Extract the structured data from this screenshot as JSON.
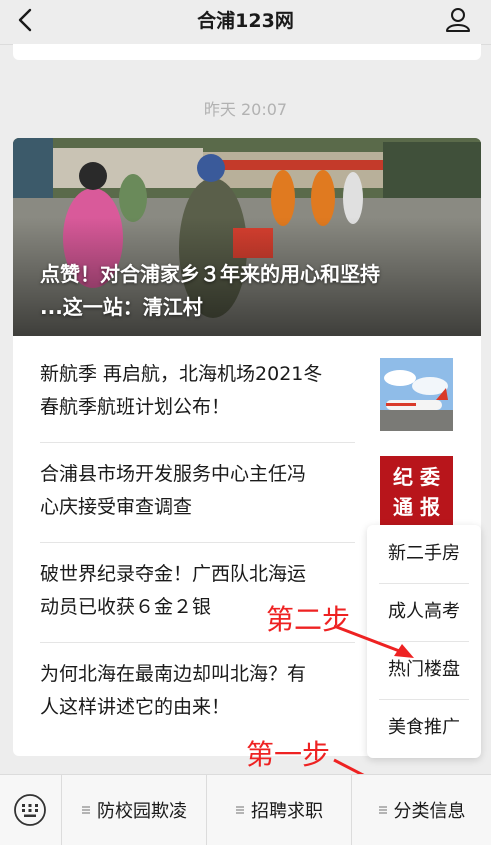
{
  "header": {
    "title": "合浦123网",
    "back_icon": "back-arrow-icon",
    "profile_icon": "user-icon"
  },
  "timestamp": "昨天 20:07",
  "hero": {
    "title_line1": "点赞！对合浦家乡３年来的用心和坚持",
    "title_line2": "...这一站：清江村"
  },
  "articles": [
    {
      "title_line1": "新航季 再启航，北海机场2021冬",
      "title_line2": "春航季航班计划公布！"
    },
    {
      "title_line1": "合浦县市场开发服务中心主任冯",
      "title_line2": "心庆接受审查调查"
    },
    {
      "title_line1": "破世界纪录夺金！广西队北海运",
      "title_line2": "动员已收获６金２银"
    },
    {
      "title_line1": "为何北海在最南边却叫北海？有",
      "title_line2": "人这样讲述它的由来！"
    }
  ],
  "badge": {
    "line1": "纪 委",
    "line2": "通 报"
  },
  "popup_menu": [
    "新二手房",
    "成人高考",
    "热门楼盘",
    "美食推广"
  ],
  "annotations": {
    "step2": "第二步",
    "step1": "第一步"
  },
  "bottom_menu": [
    "防校园欺凌",
    "招聘求职",
    "分类信息"
  ],
  "colors": {
    "annotation": "#ee2222",
    "badge_bg": "#b8151b",
    "page_bg": "#ededed"
  }
}
